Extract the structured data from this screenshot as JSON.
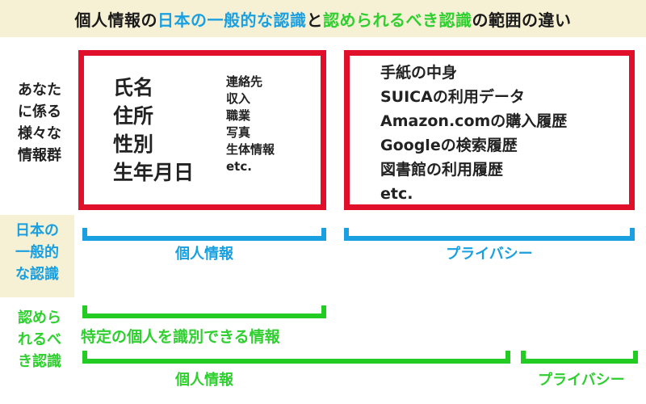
{
  "header": {
    "part1": "個人情報の",
    "part2": "日本の一般的な認識",
    "part3": "と",
    "part4": "認められるべき認識",
    "part5": "の範囲の違い"
  },
  "row_labels": {
    "info_groups": [
      "あなた",
      "に係る",
      "様々な",
      "情報群"
    ],
    "japan_common": [
      "日本の",
      "一般的",
      "な認識"
    ],
    "should_be": [
      "認めら",
      "れるべ",
      "き認識"
    ]
  },
  "left_box": {
    "big_items": [
      "氏名",
      "住所",
      "性別",
      "生年月日"
    ],
    "small_items": [
      "連絡先",
      "収入",
      "職業",
      "写真",
      "生体情報",
      "etc."
    ]
  },
  "right_box": {
    "items": [
      "手紙の中身",
      "SUICAの利用データ",
      "Amazon.comの購入履歴",
      "Googleの検索履歴",
      "図書館の利用履歴",
      "etc."
    ]
  },
  "japan_row": {
    "personal_info": "個人情報",
    "privacy": "プライバシー"
  },
  "should_row": {
    "identifiable": "特定の個人を識別できる情報",
    "personal_info": "個人情報",
    "privacy": "プライバシー"
  },
  "colors": {
    "blue": "#1aa0e0",
    "green": "#2fcf2f",
    "red": "#e0102a",
    "header_bg": "#f6f0d4"
  }
}
